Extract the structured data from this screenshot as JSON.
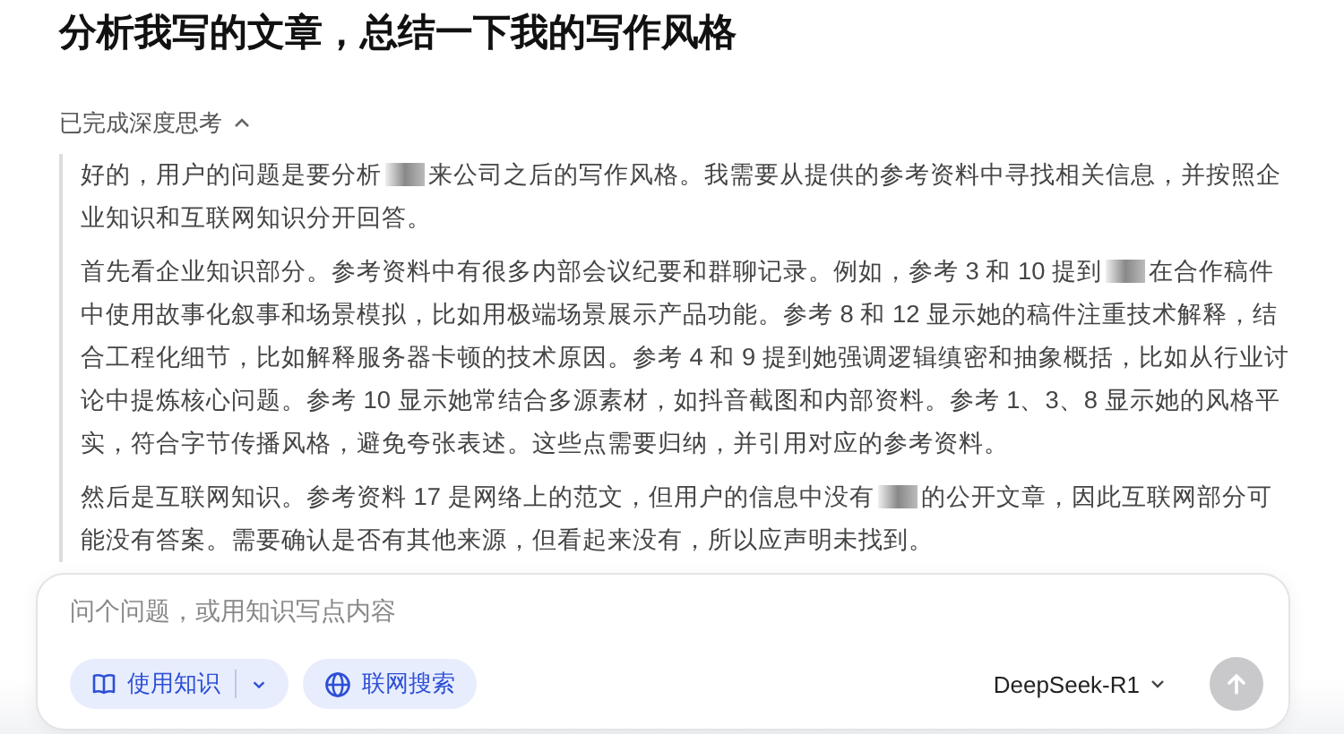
{
  "title": "分析我写的文章，总结一下我的写作风格",
  "thinking": {
    "label": "已完成深度思考",
    "expanded": true,
    "paragraphs": [
      {
        "segments": [
          "好的，用户的问题是要分析",
          "来公司之后的写作风格。我需要从提供的参考资料中寻找相关信息，并按照企业知识和互联网知识分开回答。"
        ]
      },
      {
        "segments": [
          "首先看企业知识部分。参考资料中有很多内部会议纪要和群聊记录。例如，参考 3 和 10 提到",
          "在合作稿件中使用故事化叙事和场景模拟，比如用极端场景展示产品功能。参考 8 和 12 显示她的稿件注重技术解释，结合工程化细节，比如解释服务器卡顿的技术原因。参考 4 和 9 提到她强调逻辑缜密和抽象概括，比如从行业讨论中提炼核心问题。参考 10 显示她常结合多源素材，如抖音截图和内部资料。参考 1、3、8 显示她的风格平实，符合字节传播风格，避免夸张表述。这些点需要归纳，并引用对应的参考资料。"
        ]
      },
      {
        "segments": [
          "然后是互联网知识。参考资料 17 是网络上的范文，但用户的信息中没有",
          "的公开文章，因此互联网部分可能没有答案。需要确认是否有其他来源，但看起来没有，所以应声明未找到。"
        ]
      }
    ]
  },
  "composer": {
    "placeholder": "问个问题，或用知识写点内容",
    "tools": [
      {
        "kind": "knowledge",
        "label": "使用知识"
      },
      {
        "kind": "web",
        "label": "联网搜索"
      }
    ],
    "model": "DeepSeek-R1",
    "send": {
      "disabled": true
    }
  }
}
